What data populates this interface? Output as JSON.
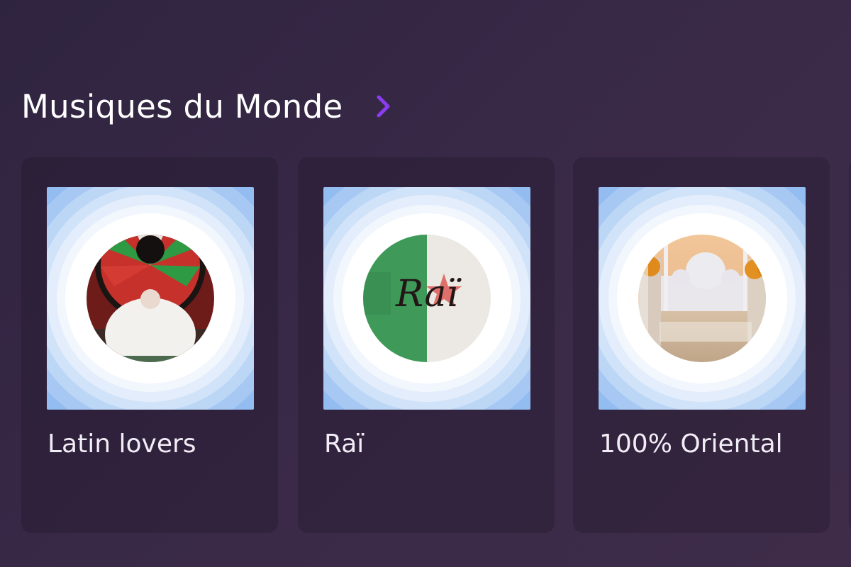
{
  "section": {
    "title": "Musiques du Monde",
    "chevron_icon": "chevron-right-icon",
    "accent_color": "#8b3cf0"
  },
  "cards": [
    {
      "title": "Latin lovers",
      "image": "mariachi-sombrero-photo"
    },
    {
      "title": "Raï",
      "image": "algerian-flag-photo",
      "cover_text": "Raï"
    },
    {
      "title": "100% Oriental",
      "image": "mosque-photo"
    }
  ],
  "colors": {
    "background": "#35283f",
    "card": "#2c2136",
    "cover_outer": "#93bcf1"
  }
}
